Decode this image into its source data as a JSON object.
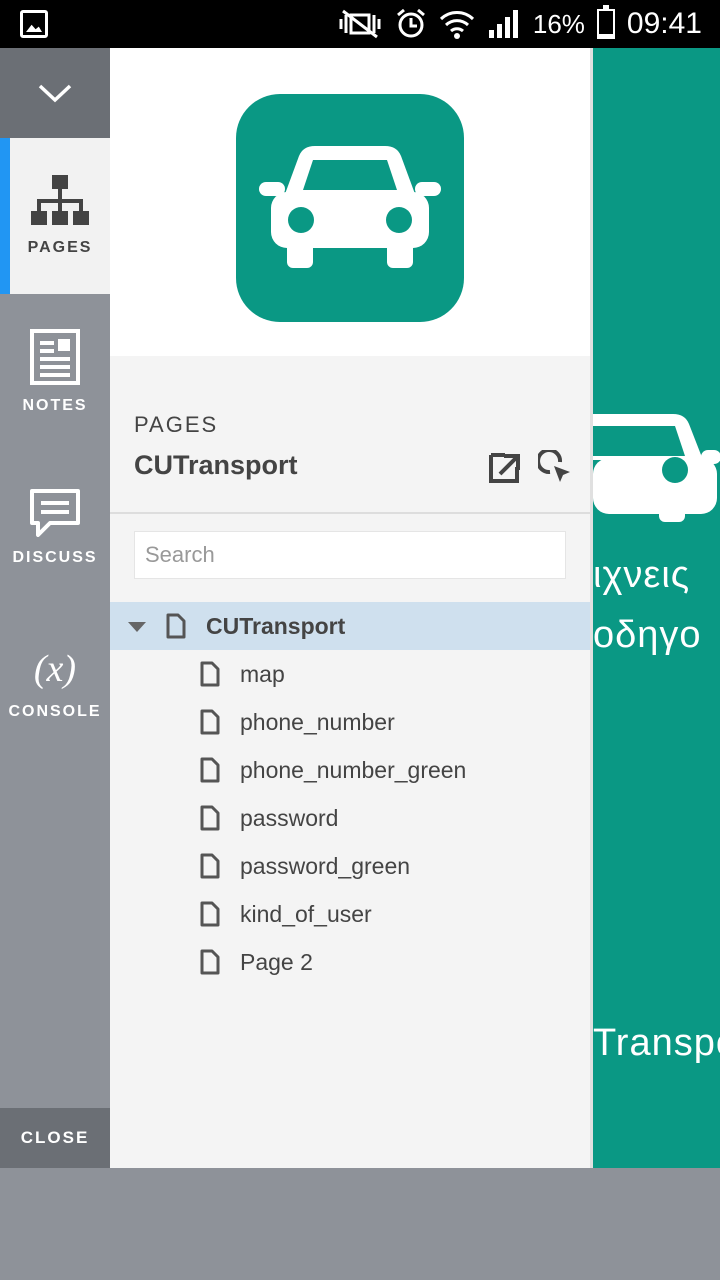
{
  "status_bar": {
    "battery_pct": "16%",
    "time": "09:41"
  },
  "rail": {
    "items": [
      {
        "label": "PAGES",
        "icon": "sitemap-icon"
      },
      {
        "label": "NOTES",
        "icon": "notes-icon"
      },
      {
        "label": "DISCUSS",
        "icon": "chat-icon"
      },
      {
        "label": "CONSOLE",
        "icon": "function-icon"
      }
    ],
    "console_glyph": "(x)",
    "close_label": "CLOSE"
  },
  "panel": {
    "section_label": "PAGES",
    "project_title": "CUTransport",
    "search_placeholder": "Search",
    "tree": {
      "root": "CUTransport",
      "children": [
        "map",
        "phone_number",
        "phone_number_green",
        "password",
        "password_green",
        "kind_of_user",
        "Page 2"
      ]
    }
  },
  "preview": {
    "line1": "ιχνεις",
    "line2": "οδηγο",
    "line3": "Transpo"
  },
  "colors": {
    "accent": "#0a9884",
    "active_bar": "#2196f3",
    "selected_row": "#cfe0ee",
    "rail": "#8e9299"
  }
}
